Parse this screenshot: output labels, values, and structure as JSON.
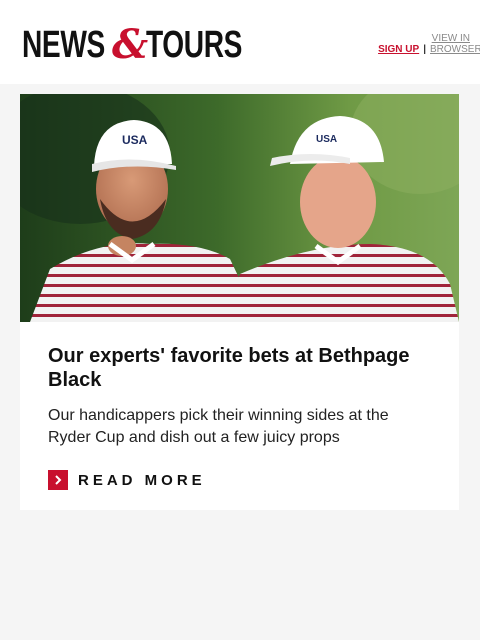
{
  "header": {
    "logo_left": "NEWS",
    "logo_amp": "&",
    "logo_right": "TOURS",
    "signup_label": "SIGN UP",
    "separator": "|",
    "view_in_browser_label": "VIEW IN BROWSER"
  },
  "article": {
    "image_alt": "Two golfers in white USA caps and red-striped polo shirts on a golf course",
    "cap_text": "USA",
    "headline": "Our experts' favorite bets at Bethpage Black",
    "summary": "Our handicappers pick their winning sides at the Ryder Cup and dish out a few juicy props",
    "read_more_label": "READ MORE"
  },
  "colors": {
    "brand_red": "#c8102e",
    "text_dark": "#111111",
    "page_bg": "#f5f5f5"
  },
  "icons": {
    "read_more": "chevron-right-icon"
  }
}
